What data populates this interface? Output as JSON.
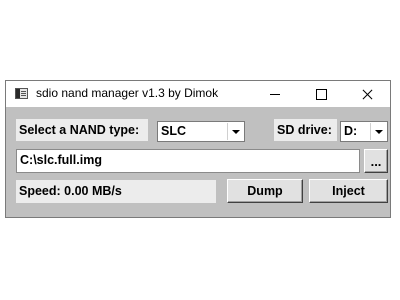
{
  "window": {
    "title": "sdio nand manager v1.3 by Dimok"
  },
  "nand": {
    "label": "Select a NAND type:",
    "selected": "SLC"
  },
  "sd": {
    "label": "SD drive:",
    "selected": "D:"
  },
  "path": {
    "value": "C:\\slc.full.img",
    "browse_label": "..."
  },
  "status": {
    "speed": "Speed: 0.00 MB/s"
  },
  "actions": {
    "dump_label": "Dump",
    "inject_label": "Inject"
  },
  "icons": {
    "app": "app-window-icon",
    "minimize": "minimize-icon",
    "maximize": "maximize-icon",
    "close": "close-icon",
    "dropdown": "chevron-down-icon"
  }
}
